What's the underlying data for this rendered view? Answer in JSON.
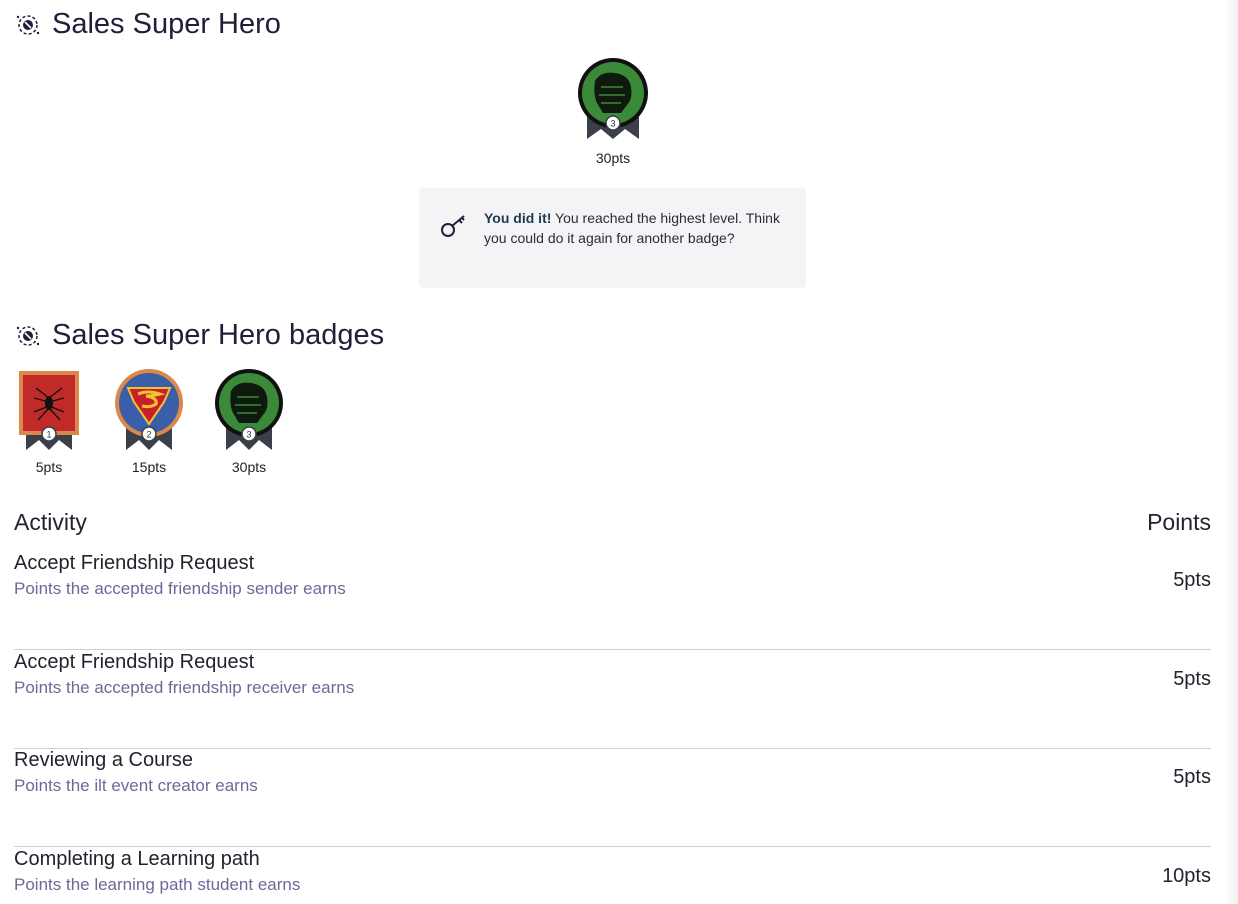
{
  "header": {
    "title": "Sales Super Hero"
  },
  "current_badge": {
    "name": "hulk-badge",
    "level": "3",
    "points": "30pts"
  },
  "notice": {
    "strong": "You did it!",
    "text": " You reached the highest level. Think you could do it again for another badge?"
  },
  "badges_section": {
    "title": "Sales Super Hero badges",
    "badges": [
      {
        "name": "spider-badge",
        "level": "1",
        "points": "5pts"
      },
      {
        "name": "superman-badge",
        "level": "2",
        "points": "15pts"
      },
      {
        "name": "hulk-badge",
        "level": "3",
        "points": "30pts"
      }
    ]
  },
  "activity": {
    "col_activity": "Activity",
    "col_points": "Points",
    "rows": [
      {
        "name": "Accept Friendship Request",
        "desc": "Points the accepted friendship sender earns",
        "points": "5pts"
      },
      {
        "name": "Accept Friendship Request",
        "desc": "Points the accepted friendship receiver earns",
        "points": "5pts"
      },
      {
        "name": "Reviewing a Course",
        "desc": "Points the ilt event creator earns",
        "points": "5pts"
      },
      {
        "name": "Completing a Learning path",
        "desc": "Points the learning path student earns",
        "points": "10pts"
      }
    ]
  }
}
